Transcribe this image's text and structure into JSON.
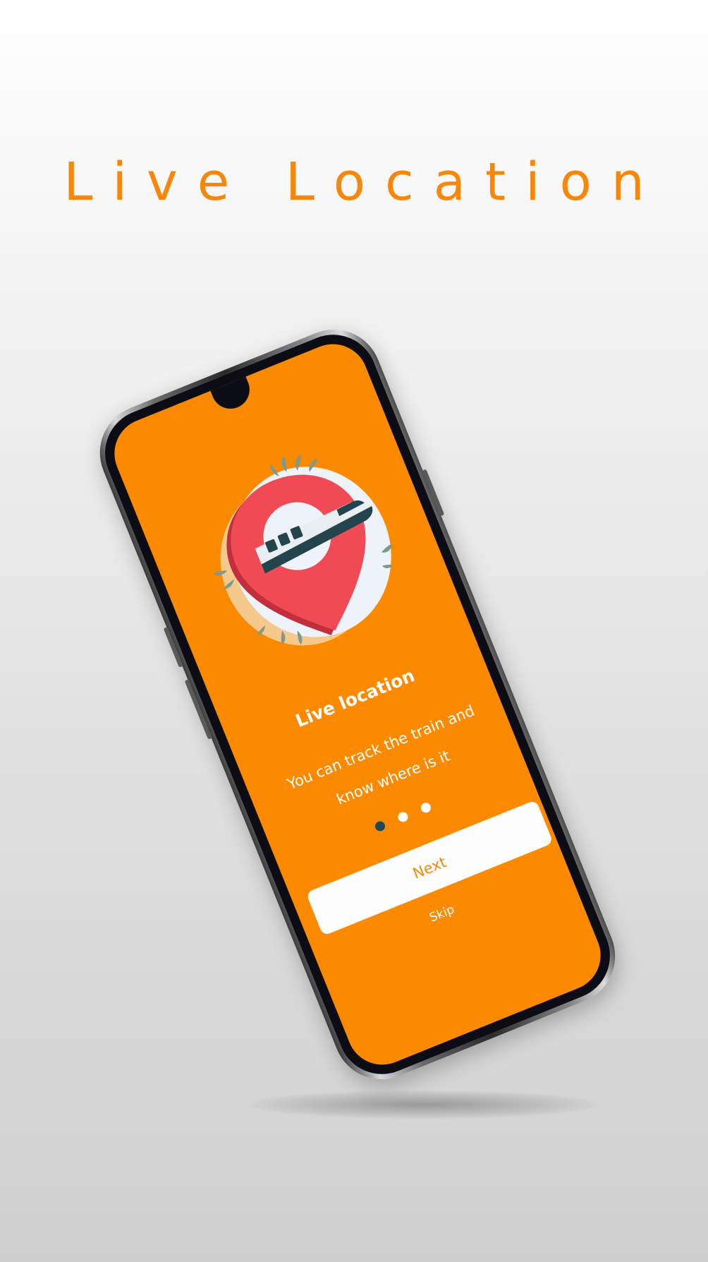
{
  "promo": {
    "title": "Live Location"
  },
  "app_screen": {
    "title": "Live location",
    "description": "You can track the train and know where is it",
    "pagination": {
      "total": 3,
      "current": 1
    },
    "next_label": "Next",
    "skip_label": "Skip",
    "illustration_icon": "train-location-pin-icon"
  },
  "colors": {
    "accent": "#f7870a",
    "screen_background": "#fb8a00",
    "pin": "#f04a55",
    "active_dot": "#1f4a55",
    "button_background": "#fdfdfd"
  }
}
